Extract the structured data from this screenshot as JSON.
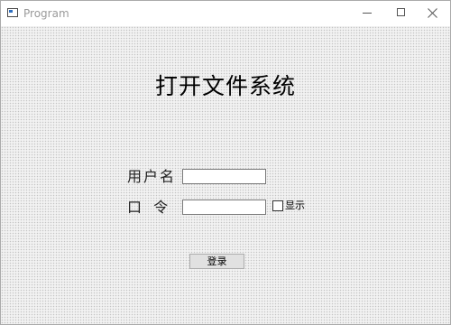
{
  "window": {
    "title": "Program",
    "icons": {
      "app": "app-window-icon",
      "minimize": "minimize-icon",
      "maximize": "maximize-icon",
      "close": "close-icon"
    }
  },
  "form": {
    "heading": "打开文件系统",
    "username_label": "用户名",
    "username_value": "",
    "password_label": "口 令",
    "password_value": "",
    "show_password_label": "显示",
    "show_password_checked": false,
    "login_button": "登录"
  },
  "colors": {
    "background": "#f2f2f2",
    "button": "#e1e1e1",
    "title_text": "#9a9a9a"
  }
}
